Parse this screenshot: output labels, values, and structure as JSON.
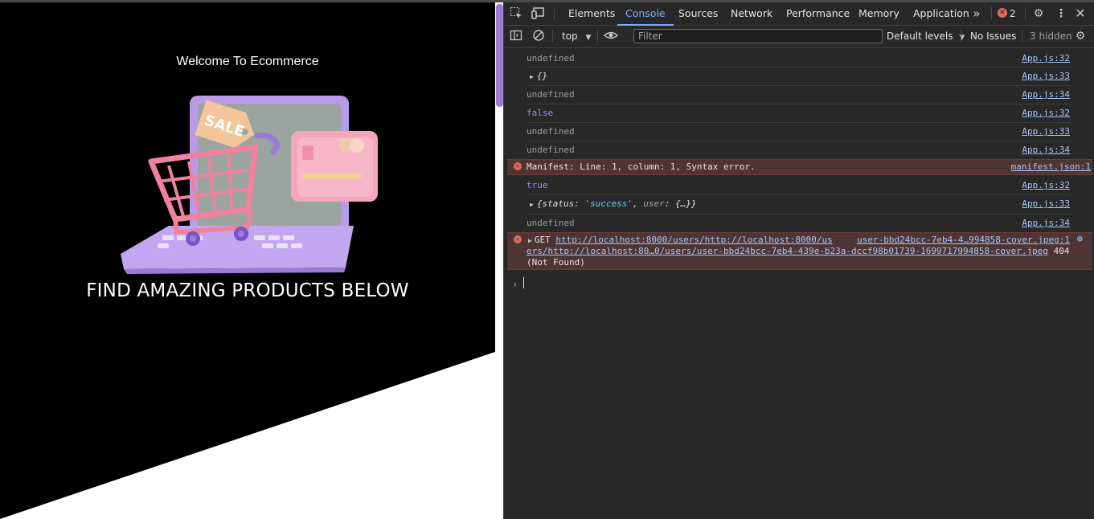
{
  "page": {
    "welcome": "Welcome To Ecommerce",
    "headline": "FIND AMAZING PRODUCTS BELOW",
    "sale_tag": "SALE"
  },
  "devtools": {
    "tabs": [
      {
        "label": "Elements"
      },
      {
        "label": "Console"
      },
      {
        "label": "Sources"
      },
      {
        "label": "Network"
      },
      {
        "label": "Performance"
      },
      {
        "label": "Memory"
      },
      {
        "label": "Application"
      }
    ],
    "more_tabs": "»",
    "error_count": "2",
    "toolbar": {
      "context": "top",
      "filter_placeholder": "Filter",
      "levels": "Default levels",
      "issues": "No Issues",
      "hidden": "3 hidden"
    },
    "console": [
      {
        "text": "undefined",
        "src": "App.js:32"
      },
      {
        "text": "{}",
        "src": "App.js:33"
      },
      {
        "text": "undefined",
        "src": "App.js:34"
      },
      {
        "text": "false",
        "src": "App.js:32"
      },
      {
        "text": "undefined",
        "src": "App.js:33"
      },
      {
        "text": "undefined",
        "src": "App.js:34"
      },
      {
        "text": "Manifest: Line: 1, column: 1, Syntax error.",
        "src": "manifest.json:1"
      },
      {
        "text": "true",
        "src": "App.js:32"
      },
      {
        "obj_open": "{status: ",
        "obj_str": "'success'",
        "obj_mid": ", ",
        "obj_key": "user",
        "obj_close": ": {…}}",
        "src": "App.js:33"
      },
      {
        "text": "undefined",
        "src": "App.js:34"
      }
    ],
    "network_error": {
      "method": "GET",
      "url_part1": "http://localhost:8000/users/http://localhost:8000/us",
      "src": "user-bbd24bcc-7eb4-4…994858-cover.jpeg:1",
      "url_part2": "ers/http://localhost:80…0/users/user-bbd24bcc-7eb4-439e-b23a-dccf98b01739-1699717994858-cover.jpeg",
      "status_code": "404",
      "status_text": "(Not Found)"
    },
    "prompt_symbol": "›"
  },
  "colors": {
    "accent": "#7cacf8",
    "error_bg": "#4e3534",
    "error_icon": "#e46962",
    "purple": "#a27ad4"
  }
}
